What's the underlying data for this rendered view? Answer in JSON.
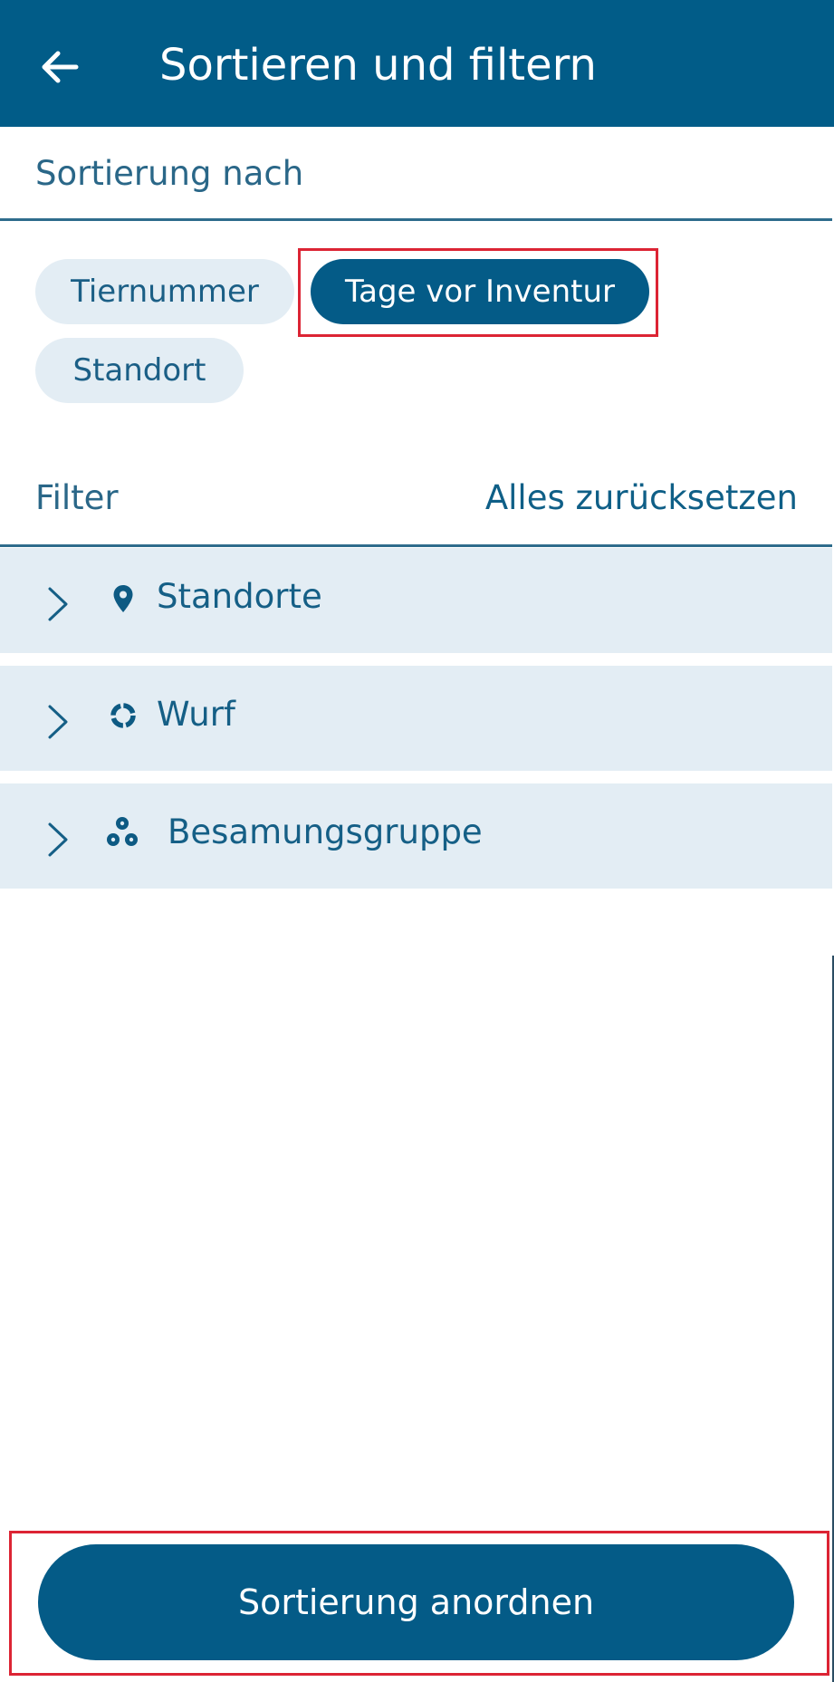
{
  "header": {
    "title": "Sortieren und filtern",
    "back_icon": "arrow-left-icon"
  },
  "sort": {
    "label": "Sortierung nach",
    "options": [
      {
        "label": "Tiernummer",
        "selected": false
      },
      {
        "label": "Tage vor Inventur",
        "selected": true
      },
      {
        "label": "Standort",
        "selected": false
      }
    ]
  },
  "filter": {
    "label": "Filter",
    "reset_label": "Alles zurücksetzen",
    "groups": [
      {
        "label": "Standorte",
        "icon": "location-pin-icon"
      },
      {
        "label": "Wurf",
        "icon": "litter-ring-icon"
      },
      {
        "label": "Besamungsgruppe",
        "icon": "group-animals-icon"
      }
    ]
  },
  "footer": {
    "apply_label": "Sortierung anordnen"
  },
  "colors": {
    "primary": "#045b87",
    "chip_background": "#e3edf4",
    "highlight": "#dc2434"
  }
}
